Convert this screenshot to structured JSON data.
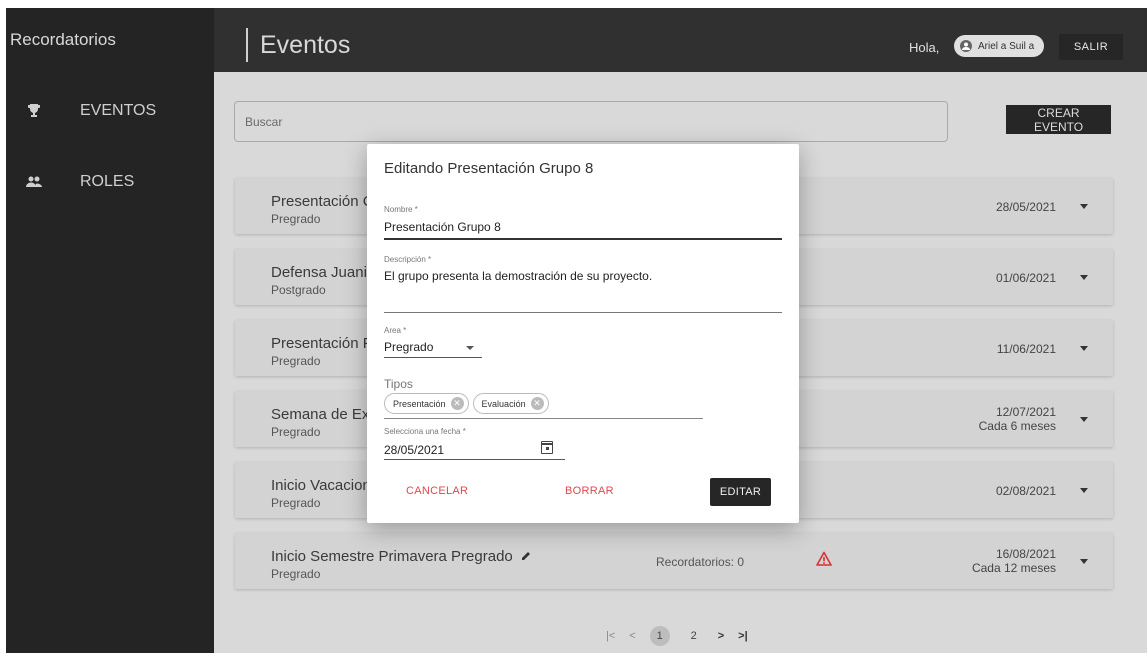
{
  "app": {
    "title": "Recordatorios"
  },
  "sidebar": {
    "items": [
      {
        "label": "EVENTOS",
        "icon": "trophy-icon"
      },
      {
        "label": "ROLES",
        "icon": "people-icon"
      }
    ]
  },
  "header": {
    "title": "Eventos",
    "greeting": "Hola,",
    "user_name": "Ariel a Suil a",
    "logout_label": "SALIR"
  },
  "toolbar": {
    "search_placeholder": "Buscar",
    "create_label": "CREAR EVENTO"
  },
  "events": [
    {
      "title": "Presentación C",
      "area": "Pregrado",
      "date": "28/05/2021",
      "recurrence": ""
    },
    {
      "title": "Defensa Juanit",
      "area": "Postgrado",
      "date": "01/06/2021",
      "recurrence": ""
    },
    {
      "title": "Presentación F",
      "area": "Pregrado",
      "date": "11/06/2021",
      "recurrence": ""
    },
    {
      "title": "Semana de Ex",
      "area": "Pregrado",
      "date": "12/07/2021",
      "recurrence": "Cada 6 meses"
    },
    {
      "title": "Inicio Vacacion",
      "area": "Pregrado",
      "date": "02/08/2021",
      "recurrence": ""
    },
    {
      "title": "Inicio Semestre Primavera Pregrado",
      "area": "Pregrado",
      "date": "16/08/2021",
      "recurrence": "Cada 12 meses",
      "reminders": "Recordatorios: 0"
    }
  ],
  "pagination": {
    "first": "|<",
    "prev": "<",
    "pages": [
      "1",
      "2"
    ],
    "current": "1",
    "next": ">",
    "last": ">|"
  },
  "modal": {
    "title": "Editando Presentación Grupo 8",
    "nombre_label": "Nombre *",
    "nombre_value": "Presentación Grupo 8",
    "descripcion_label": "Descripción *",
    "descripcion_value": "El grupo presenta la demostración de su proyecto.",
    "area_label": "Area *",
    "area_value": "Pregrado",
    "tipos_label": "Tipos",
    "tipos": [
      "Presentación",
      "Evaluación"
    ],
    "fecha_label": "Selecciona una fecha *",
    "fecha_value": "28/05/2021",
    "cancel_label": "CANCELAR",
    "delete_label": "BORRAR",
    "edit_label": "EDITAR"
  },
  "colors": {
    "sidebar_bg": "#242424",
    "header_bg": "#303030",
    "danger": "#e0474f",
    "primary_button": "#262626"
  }
}
